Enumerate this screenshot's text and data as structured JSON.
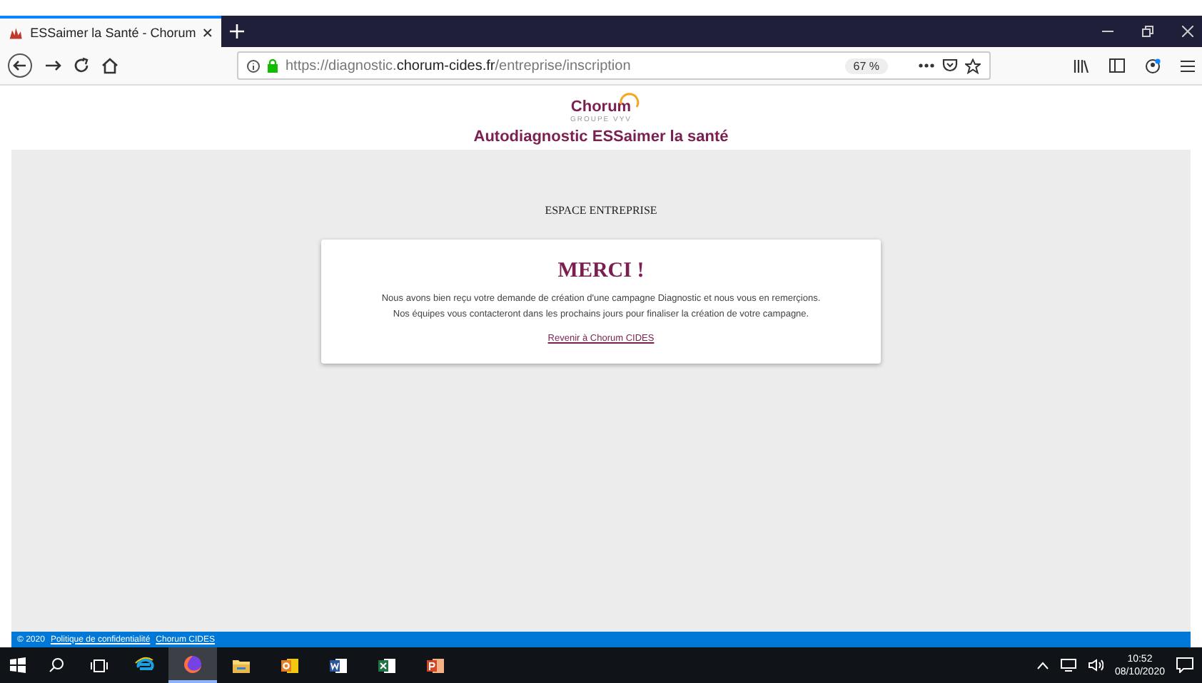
{
  "browser": {
    "tab": {
      "title": "ESSaimer la Santé - Chorum",
      "selected": true
    },
    "url_prefix": "https://diagnostic.",
    "url_domain": "chorum-cides.fr",
    "url_path": "/entreprise/inscription",
    "zoom": "67 %"
  },
  "header": {
    "logo": "Chorum",
    "logo_sub": "GROUPE VYV",
    "title": "Autodiagnostic ESSaimer la santé"
  },
  "section_title": "ESPACE ENTREPRISE",
  "card": {
    "heading": "MERCI !",
    "lines": [
      "Nous avons bien reçu votre demande de création d'une campagne Diagnostic et nous vous en remerçions.",
      "Nos équipes vous contacteront dans les prochains jours pour finaliser la création de votre campagne."
    ],
    "link": "Revenir à Chorum CIDES"
  },
  "footer": {
    "copyright": "© 2020",
    "links": [
      "Politique de confidentialité",
      "Chorum CIDES"
    ]
  },
  "taskbar": {
    "apps": [
      {
        "kind": "ie",
        "selected": false
      },
      {
        "kind": "firefox",
        "selected": true
      },
      {
        "kind": "folder",
        "selected": false
      },
      {
        "kind": "outlook",
        "selected": false
      },
      {
        "kind": "word",
        "selected": false
      },
      {
        "kind": "excel",
        "selected": false
      },
      {
        "kind": "powerpoint",
        "selected": false
      }
    ],
    "time": "10:52",
    "date": "08/10/2020"
  }
}
